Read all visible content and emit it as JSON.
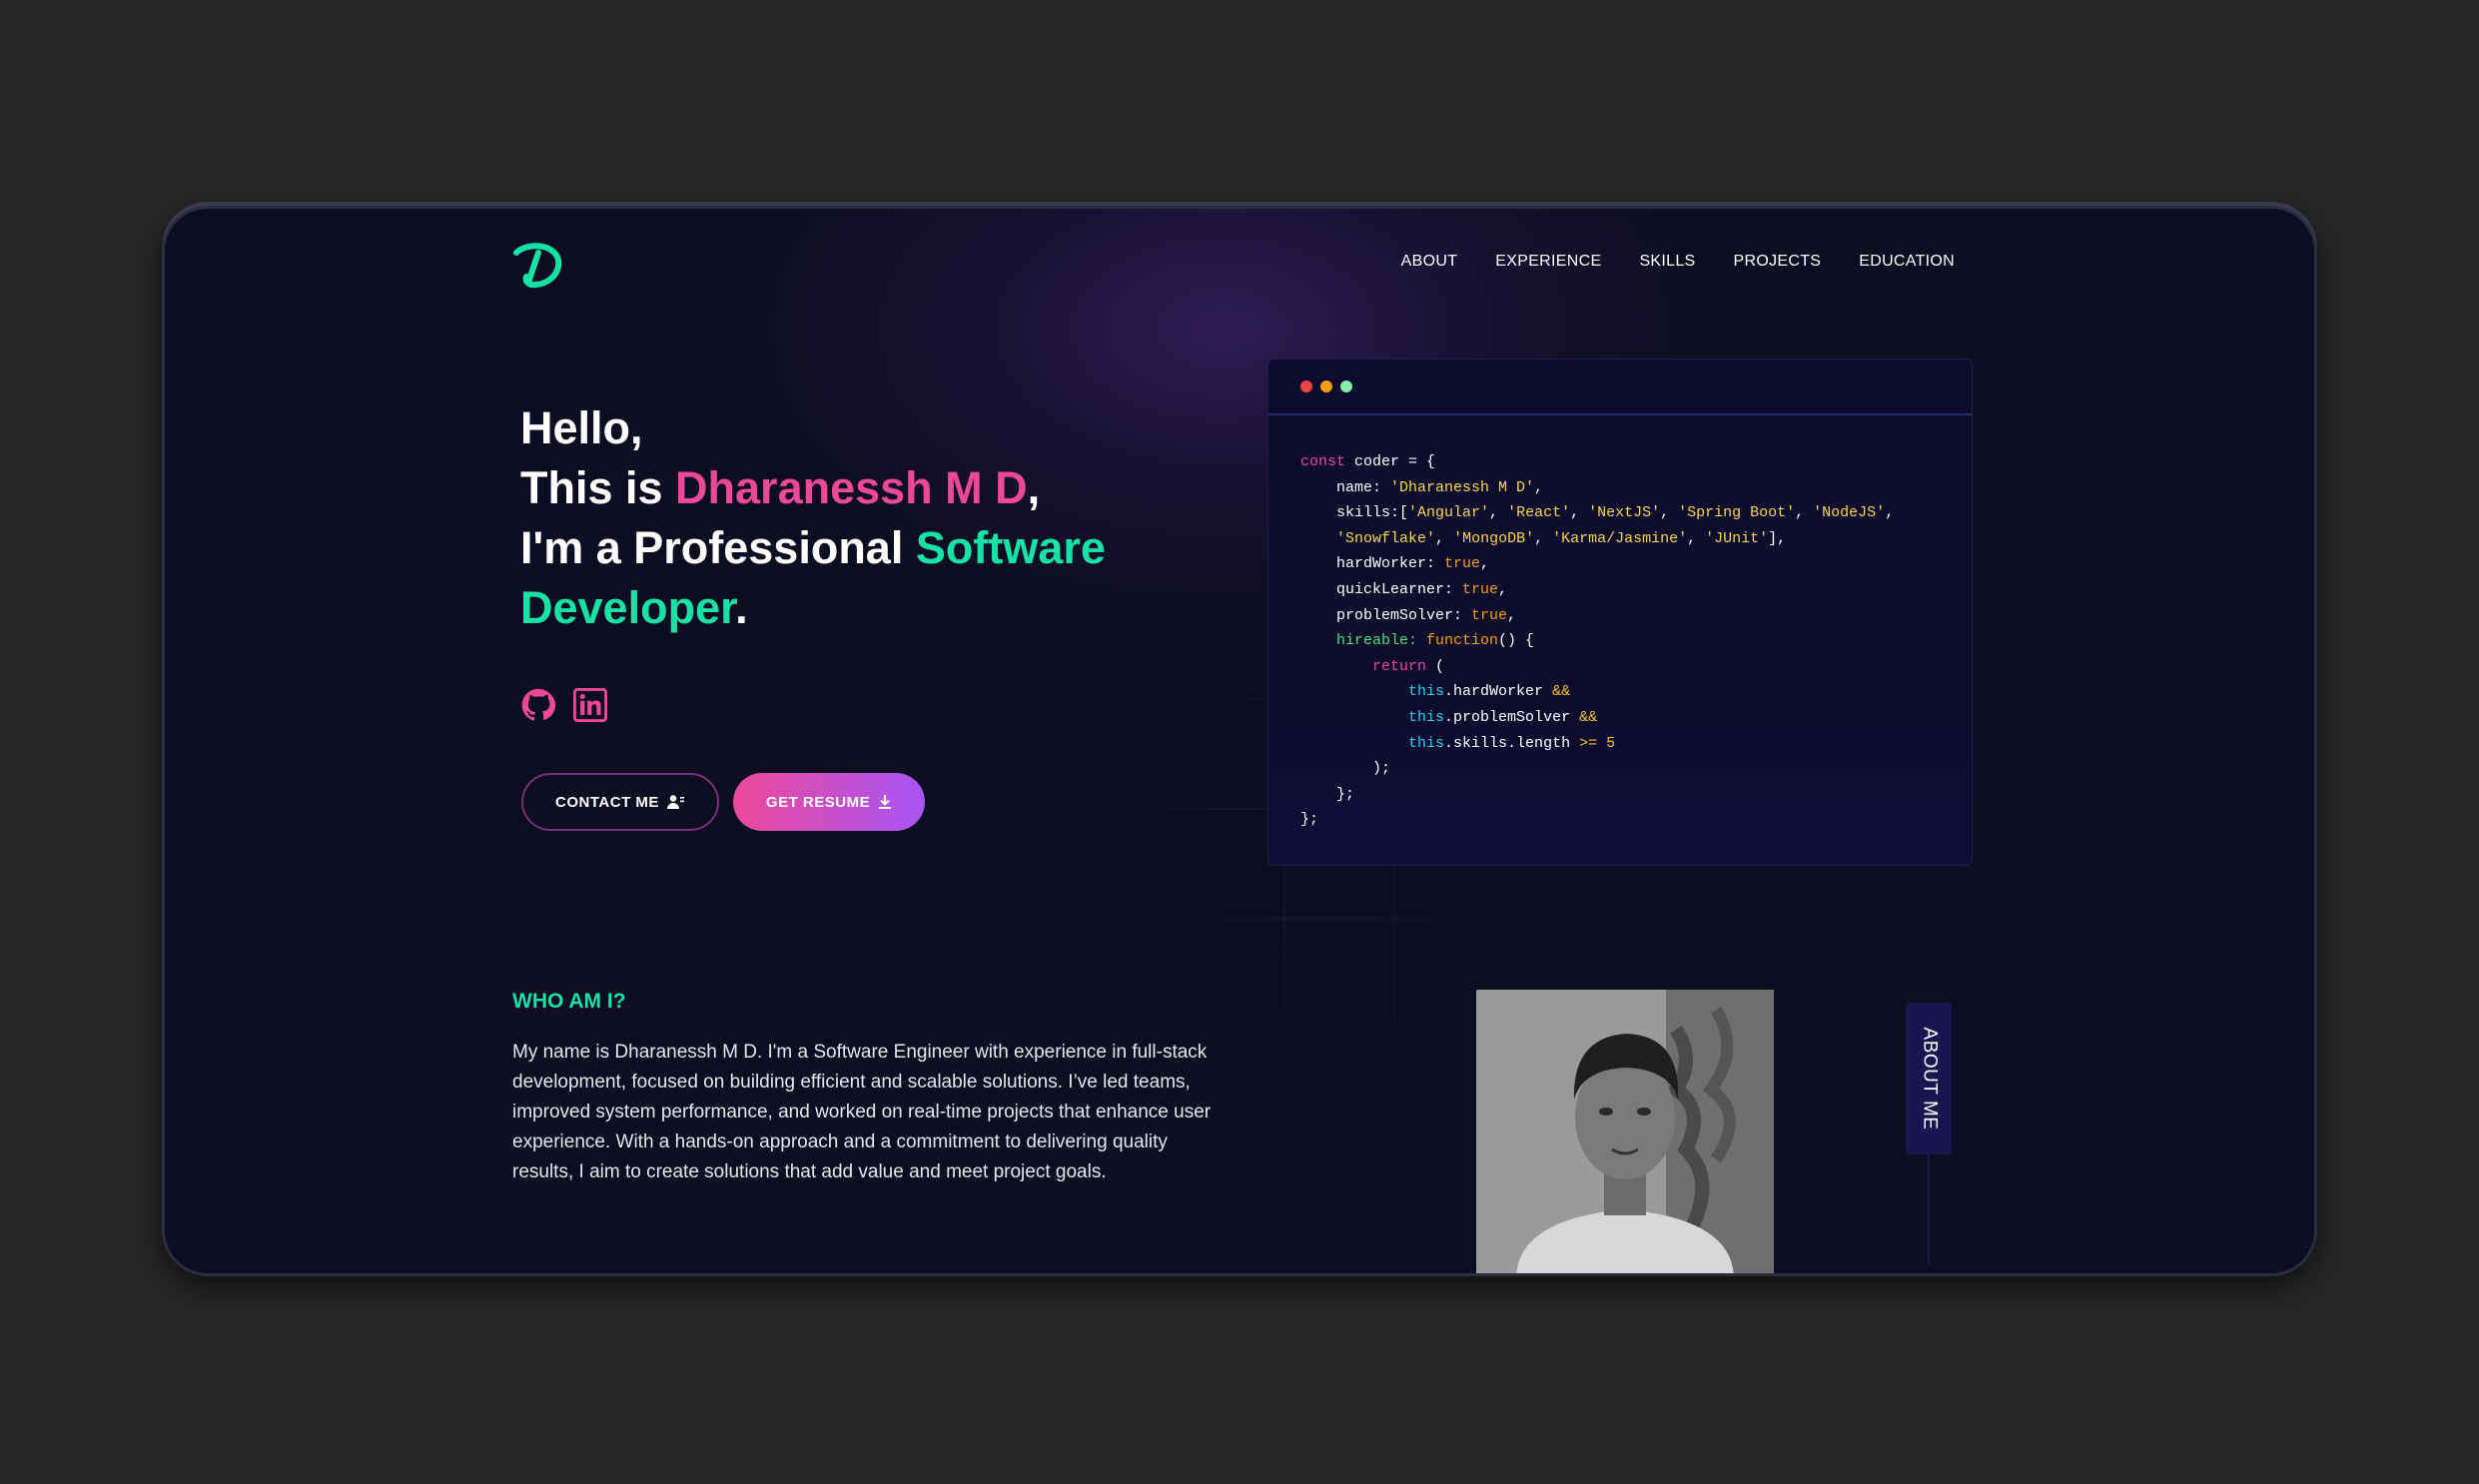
{
  "nav": {
    "logo_icon": "d-logo-icon",
    "items": [
      {
        "label": "ABOUT"
      },
      {
        "label": "EXPERIENCE"
      },
      {
        "label": "SKILLS"
      },
      {
        "label": "PROJECTS"
      },
      {
        "label": "EDUCATION"
      }
    ]
  },
  "hero": {
    "line1": "Hello,",
    "line2_prefix": "This is ",
    "name": "Dharanessh M D",
    "line2_suffix": ",",
    "line3_prefix": "I'm a Professional ",
    "role": "Software Developer",
    "line3_suffix": "."
  },
  "socials": [
    {
      "icon": "github-icon"
    },
    {
      "icon": "linkedin-icon"
    }
  ],
  "buttons": {
    "contact_label": "CONTACT ME",
    "contact_icon": "user-contact-icon",
    "resume_label": "GET RESUME",
    "resume_icon": "download-icon"
  },
  "code_card": {
    "dots": [
      "#ef4444",
      "#f59e0b",
      "#86efac"
    ],
    "lines": {
      "l1_kw": "const",
      "l1_name": " coder = {",
      "l2_key": "    name: ",
      "l2_val": "'Dharanessh M D'",
      "l3_key": "    skills:[",
      "s1": "'Angular'",
      "s2": "'React'",
      "s3": "'NextJS'",
      "s4": "'Spring Boot'",
      "s5": "'NodeJS'",
      "s6": "'Snowflake'",
      "s7": "'MongoDB'",
      "s8": "'Karma/Jasmine'",
      "s9": "'JUnit'",
      "l5_key": "    hardWorker: ",
      "l6_key": "    quickLearner: ",
      "l7_key": "    problemSolver: ",
      "true": "true",
      "l8_key": "    hireable: ",
      "l8_fn": "function",
      "l8_rest": "() {",
      "l9_kw": "        return",
      "l9_rest": " (",
      "this": "this",
      "l10": ".hardWorker ",
      "l11": ".problemSolver ",
      "l12": ".skills.length ",
      "and": "&&",
      "gte": ">= 5",
      "l13": "        );",
      "l14": "    };",
      "l15": "};"
    }
  },
  "about": {
    "heading": "WHO AM I?",
    "text": "My name is Dharanessh M D. I'm a Software Engineer with experience in full-stack development, focused on building efficient and scalable solutions. I’ve led teams, improved system performance, and worked on real-time projects that enhance user experience. With a hands-on approach and a commitment to delivering quality results, I aim to create solutions that add value and meet project goals.",
    "side_tab": "ABOUT ME"
  }
}
